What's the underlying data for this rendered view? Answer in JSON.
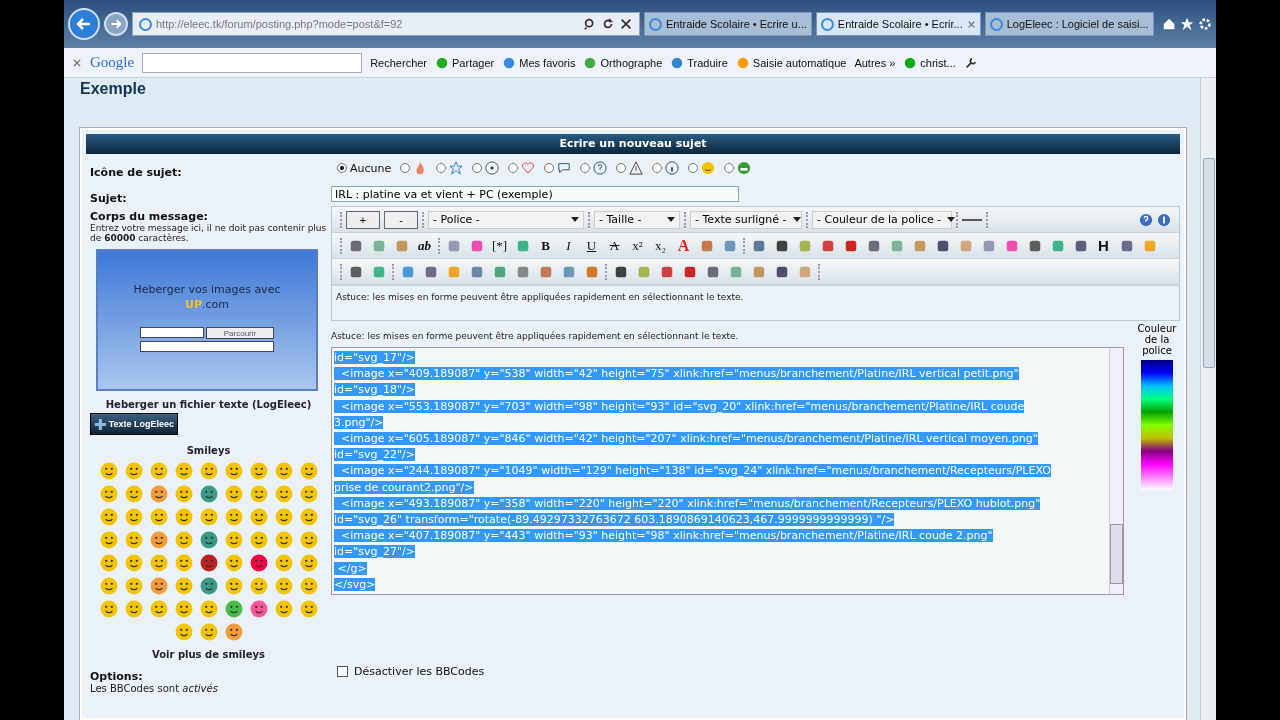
{
  "browser": {
    "address": "http://eleec.tk/forum/posting.php?mode=post&f=92",
    "tabs": [
      {
        "label": "Entraide Scolaire • Ecrire u...",
        "selected": false,
        "closable": false
      },
      {
        "label": "Entraide Scolaire • Ecrir...",
        "selected": true,
        "closable": true
      },
      {
        "label": "LogEleec : Logiciel de saisi...",
        "selected": false,
        "closable": false
      }
    ],
    "toolbar": {
      "logo": "Google",
      "search_button": "Rechercher",
      "items": [
        {
          "kind": "share",
          "label": "Partager"
        },
        {
          "kind": "star",
          "label": "Mes favoris"
        },
        {
          "kind": "spell",
          "label": "Orthographe"
        },
        {
          "kind": "translate",
          "label": "Traduire"
        },
        {
          "kind": "pen",
          "label": "Saisie automatique"
        },
        {
          "kind": "more",
          "label": "Autres »"
        },
        {
          "kind": "dot",
          "label": "christ..."
        }
      ]
    }
  },
  "page": {
    "title": "Exemple",
    "panel_title": "Ecrire un nouveau sujet",
    "topic_icon": {
      "label": "Icône de sujet:",
      "options": [
        {
          "kind": "none",
          "label": "Aucune",
          "selected": true
        },
        {
          "kind": "flame",
          "selected": false
        },
        {
          "kind": "star",
          "selected": false
        },
        {
          "kind": "radiation",
          "selected": false
        },
        {
          "kind": "heart",
          "selected": false
        },
        {
          "kind": "bubble",
          "selected": false
        },
        {
          "kind": "question",
          "selected": false
        },
        {
          "kind": "warning",
          "selected": false
        },
        {
          "kind": "info",
          "selected": false
        },
        {
          "kind": "smile",
          "selected": false
        },
        {
          "kind": "grin",
          "selected": false
        }
      ]
    },
    "subject": {
      "label": "Sujet:",
      "value": "IRL : platine va et vient + PC (exemple)"
    },
    "body": {
      "label": "Corps du message:",
      "help": "Entrez votre message ici, il ne doit pas contenir plus de **60000** caractères."
    },
    "image_host": {
      "title": "Heberger vos images avec",
      "brand": "UP",
      "brand_suffix": ".com",
      "browse": "Parcourir"
    },
    "text_host": {
      "title": "Heberger un fichier texte (LogEleec)",
      "button": "Texte LogEleec"
    },
    "smileys": {
      "title": "Smileys",
      "more": "Voir plus de smileys"
    },
    "options": {
      "title": "Options:",
      "lines": [
        "Les BBCodes sont *activés*"
      ],
      "checkboxes": [
        {
          "label": "Désactiver les BBCodes",
          "checked": false
        }
      ]
    },
    "editor": {
      "size_buttons": [
        "+",
        "-"
      ],
      "selects": [
        "- Police -",
        "- Taille -",
        "- Texte surligné -",
        "- Couleur de la police -"
      ],
      "row2": [
        {
          "kind": "icon"
        },
        {
          "kind": "icon"
        },
        {
          "kind": "icon"
        },
        {
          "kind": "bolditalic",
          "label": "ab"
        },
        {
          "kind": "sep"
        },
        {
          "kind": "icon"
        },
        {
          "kind": "icon"
        },
        {
          "kind": "plain",
          "label": "[*]"
        },
        {
          "kind": "icon"
        },
        {
          "kind": "bold",
          "label": "B"
        },
        {
          "kind": "italic",
          "label": "I"
        },
        {
          "kind": "underline",
          "label": "U"
        },
        {
          "kind": "strike",
          "label": "A"
        },
        {
          "kind": "plain",
          "label": "x²"
        },
        {
          "kind": "plain",
          "label": "x₂"
        },
        {
          "kind": "red",
          "label": "A"
        },
        {
          "kind": "icon"
        },
        {
          "kind": "icon"
        },
        {
          "kind": "sep"
        },
        {
          "kind": "icon"
        },
        {
          "kind": "icon"
        },
        {
          "kind": "icon"
        },
        {
          "kind": "icon"
        },
        {
          "kind": "icon"
        },
        {
          "kind": "icon"
        },
        {
          "kind": "icon"
        },
        {
          "kind": "icon"
        },
        {
          "kind": "icon"
        },
        {
          "kind": "icon"
        },
        {
          "kind": "icon"
        },
        {
          "kind": "icon"
        },
        {
          "kind": "icon"
        },
        {
          "kind": "icon"
        },
        {
          "kind": "icon"
        },
        {
          "kind": "heading",
          "label": "H"
        },
        {
          "kind": "icon"
        },
        {
          "kind": "icon"
        }
      ],
      "row3": [
        {
          "kind": "icon"
        },
        {
          "kind": "icon"
        },
        {
          "kind": "sep"
        },
        {
          "kind": "icon"
        },
        {
          "kind": "icon"
        },
        {
          "kind": "icon"
        },
        {
          "kind": "icon"
        },
        {
          "kind": "icon"
        },
        {
          "kind": "icon"
        },
        {
          "kind": "icon"
        },
        {
          "kind": "icon"
        },
        {
          "kind": "icon"
        },
        {
          "kind": "sep"
        },
        {
          "kind": "icon"
        },
        {
          "kind": "icon"
        },
        {
          "kind": "icon"
        },
        {
          "kind": "icon"
        },
        {
          "kind": "icon"
        },
        {
          "kind": "icon"
        },
        {
          "kind": "icon"
        },
        {
          "kind": "icon"
        },
        {
          "kind": "icon"
        }
      ],
      "tip": "Astuce: les mises en forme peuvent être appliquées rapidement en sélectionnant le texte.",
      "tip2": "Astuce: les mises en forme peuvent être appliquées rapidement en sélectionnant le texte.",
      "palette_label": "Couleur de la police",
      "lines": [
        "id=\"svg_17\"/>",
        "  <image x=\"409.189087\" y=\"538\" width=\"42\" height=\"75\" xlink:href=\"menus/branchement/Platine/IRL vertical petit.png\"",
        "id=\"svg_18\"/>",
        "  <image x=\"553.189087\" y=\"703\" width=\"98\" height=\"93\" id=\"svg_20\" xlink:href=\"menus/branchement/Platine/IRL coude",
        "3.png\"/>",
        "  <image x=\"605.189087\" y=\"846\" width=\"42\" height=\"207\" xlink:href=\"menus/branchement/Platine/IRL vertical moyen.png\"",
        "id=\"svg_22\"/>",
        "  <image x=\"244.189087\" y=\"1049\" width=\"129\" height=\"138\" id=\"svg_24\" xlink:href=\"menus/branchement/Recepteurs/PLEXO",
        "prise de courant2.png\"/>",
        "  <image x=\"493.189087\" y=\"358\" width=\"220\" height=\"220\" xlink:href=\"menus/branchement/Recepteurs/PLEXO hublot.png\"",
        "id=\"svg_26\" transform=\"rotate(-89.49297332763672 603.1890869140623,467.9999999999999) \"/>",
        "  <image x=\"407.189087\" y=\"443\" width=\"93\" height=\"98\" xlink:href=\"menus/branchement/Platine/IRL coude 2.png\"",
        "id=\"svg_27\"/>",
        " </g>",
        "</svg>"
      ]
    }
  }
}
